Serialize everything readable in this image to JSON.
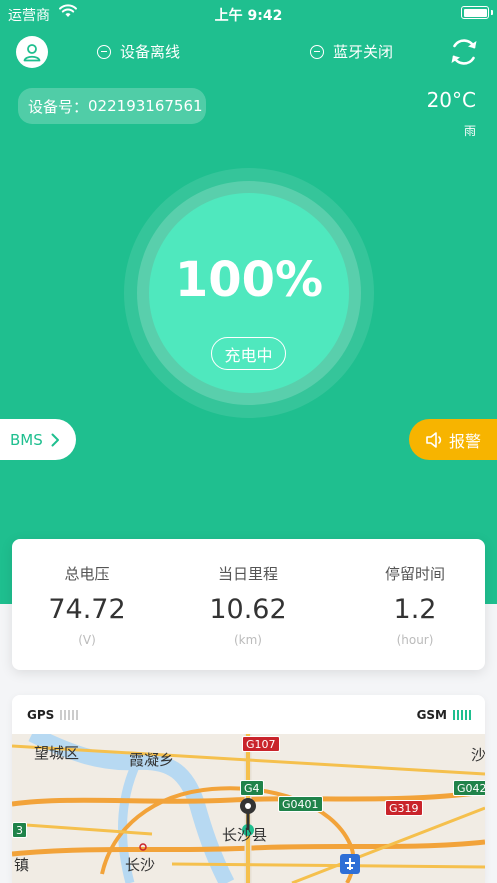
{
  "status_bar": {
    "carrier": "运营商",
    "time": "上午 9:42"
  },
  "header": {
    "device_status": "设备离线",
    "bluetooth_status": "蓝牙关闭"
  },
  "device": {
    "label": "设备号：",
    "number": "022193167561"
  },
  "weather": {
    "temperature": "20°C",
    "condition": "雨"
  },
  "battery": {
    "percent_text": "100%",
    "percent": 100,
    "state": "充电中"
  },
  "buttons": {
    "bms": "BMS",
    "alarm": "报警"
  },
  "stats": [
    {
      "title": "总电压",
      "value": "74.72",
      "unit": "(V)"
    },
    {
      "title": "当日里程",
      "value": "10.62",
      "unit": "(km)"
    },
    {
      "title": "停留时间",
      "value": "1.2",
      "unit": "(hour)"
    }
  ],
  "map": {
    "gps_label": "GPS",
    "gsm_label": "GSM",
    "places": [
      "望城区",
      "霞凝乡",
      "长沙县",
      "长沙",
      "沙",
      "镇"
    ],
    "roads": [
      "G107",
      "G4",
      "G0401",
      "G319",
      "G042",
      "3"
    ]
  },
  "colors": {
    "primary": "#1fbf8f",
    "alarm": "#f7b400",
    "inner_circle": "#4fe8be"
  }
}
